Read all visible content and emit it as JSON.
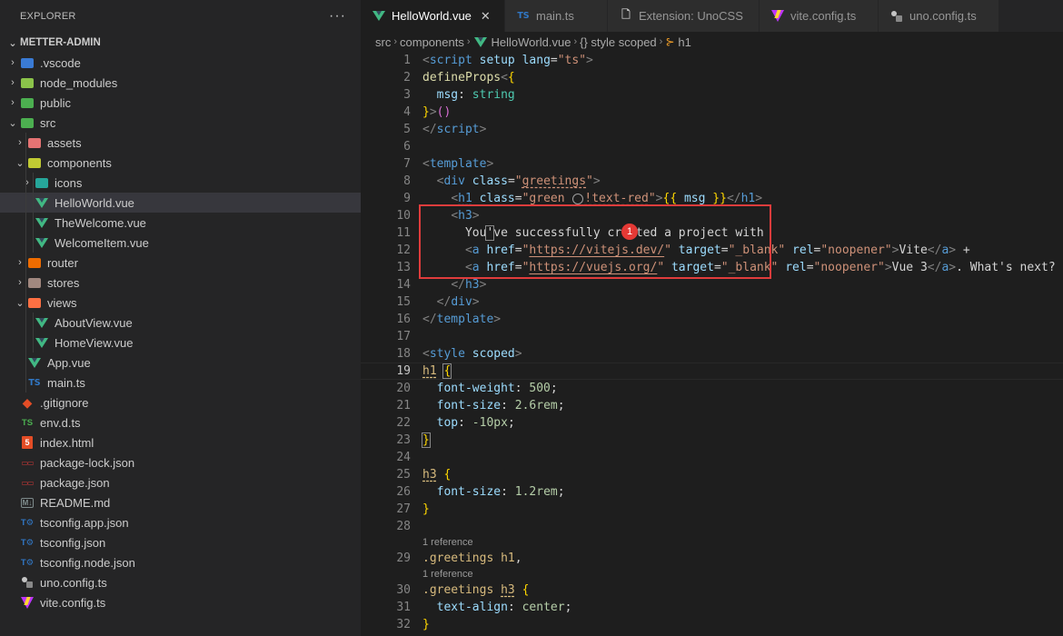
{
  "explorer": {
    "title": "EXPLORER",
    "more": "···",
    "project": "METTER-ADMIN",
    "items": [
      {
        "label": ".vscode",
        "icon": "vscode-folder-icon",
        "kind": "folder-closed",
        "depth": 0
      },
      {
        "label": "node_modules",
        "icon": "node-folder-icon",
        "kind": "folder-closed",
        "depth": 0
      },
      {
        "label": "public",
        "icon": "public-folder-icon",
        "kind": "folder-closed",
        "depth": 0
      },
      {
        "label": "src",
        "icon": "src-folder-icon",
        "kind": "folder-open",
        "depth": 0
      },
      {
        "label": "assets",
        "icon": "assets-folder-icon",
        "kind": "folder-closed",
        "depth": 1
      },
      {
        "label": "components",
        "icon": "components-folder-icon",
        "kind": "folder-open",
        "depth": 1
      },
      {
        "label": "icons",
        "icon": "icons-folder-icon",
        "kind": "folder-closed",
        "depth": 2
      },
      {
        "label": "HelloWorld.vue",
        "icon": "vue-file-icon",
        "kind": "file",
        "depth": 2,
        "selected": true
      },
      {
        "label": "TheWelcome.vue",
        "icon": "vue-file-icon",
        "kind": "file",
        "depth": 2
      },
      {
        "label": "WelcomeItem.vue",
        "icon": "vue-file-icon",
        "kind": "file",
        "depth": 2
      },
      {
        "label": "router",
        "icon": "router-folder-icon",
        "kind": "folder-closed",
        "depth": 1
      },
      {
        "label": "stores",
        "icon": "stores-folder-icon",
        "kind": "folder-closed",
        "depth": 1
      },
      {
        "label": "views",
        "icon": "views-folder-icon",
        "kind": "folder-open",
        "depth": 1
      },
      {
        "label": "AboutView.vue",
        "icon": "vue-file-icon",
        "kind": "file",
        "depth": 2
      },
      {
        "label": "HomeView.vue",
        "icon": "vue-file-icon",
        "kind": "file",
        "depth": 2
      },
      {
        "label": "App.vue",
        "icon": "vue-file-icon",
        "kind": "file",
        "depth": 1
      },
      {
        "label": "main.ts",
        "icon": "ts-file-icon",
        "kind": "file",
        "depth": 1
      },
      {
        "label": ".gitignore",
        "icon": "git-file-icon",
        "kind": "file",
        "depth": 0
      },
      {
        "label": "env.d.ts",
        "icon": "dts-file-icon",
        "kind": "file",
        "depth": 0
      },
      {
        "label": "index.html",
        "icon": "html-file-icon",
        "kind": "file",
        "depth": 0
      },
      {
        "label": "package-lock.json",
        "icon": "npm-file-icon",
        "kind": "file",
        "depth": 0
      },
      {
        "label": "package.json",
        "icon": "npm-file-icon",
        "kind": "file",
        "depth": 0
      },
      {
        "label": "README.md",
        "icon": "markdown-file-icon",
        "kind": "file",
        "depth": 0
      },
      {
        "label": "tsconfig.app.json",
        "icon": "tsconfig-file-icon",
        "kind": "file",
        "depth": 0
      },
      {
        "label": "tsconfig.json",
        "icon": "tsconfig-file-icon",
        "kind": "file",
        "depth": 0
      },
      {
        "label": "tsconfig.node.json",
        "icon": "tsconfig-file-icon",
        "kind": "file",
        "depth": 0
      },
      {
        "label": "uno.config.ts",
        "icon": "unocss-file-icon",
        "kind": "file",
        "depth": 0
      },
      {
        "label": "vite.config.ts",
        "icon": "vite-file-icon",
        "kind": "file",
        "depth": 0
      }
    ]
  },
  "tabs": [
    {
      "label": "HelloWorld.vue",
      "icon": "vue-file-icon",
      "active": true,
      "close": "✕"
    },
    {
      "label": "main.ts",
      "icon": "ts-file-icon",
      "active": false
    },
    {
      "label": "Extension: UnoCSS",
      "icon": "extension-page-icon",
      "active": false
    },
    {
      "label": "vite.config.ts",
      "icon": "vite-file-icon",
      "active": false
    },
    {
      "label": "uno.config.ts",
      "icon": "unocss-file-icon",
      "active": false
    }
  ],
  "breadcrumb": {
    "src": "src",
    "components": "components",
    "file": "HelloWorld.vue",
    "style": "{} style scoped",
    "h1": "h1"
  },
  "badge": "1",
  "code_lens": "1 reference",
  "lines": [
    {
      "n": "1",
      "tokens": [
        [
          "t-punc",
          "<"
        ],
        [
          "t-tag",
          "script"
        ],
        [
          "t-plain",
          " "
        ],
        [
          "t-attr",
          "setup"
        ],
        [
          "t-plain",
          " "
        ],
        [
          "t-attr",
          "lang"
        ],
        [
          "t-plain",
          "="
        ],
        [
          "t-str",
          "\"ts\""
        ],
        [
          "t-punc",
          ">"
        ]
      ]
    },
    {
      "n": "2",
      "tokens": [
        [
          "t-func",
          "defineProps"
        ],
        [
          "t-punc",
          "<"
        ],
        [
          "t-brace",
          "{"
        ]
      ]
    },
    {
      "n": "3",
      "indent": 1,
      "tokens": [
        [
          "t-plain",
          "  "
        ],
        [
          "t-attr",
          "msg"
        ],
        [
          "t-plain",
          ": "
        ],
        [
          "t-type",
          "string"
        ]
      ]
    },
    {
      "n": "4",
      "tokens": [
        [
          "t-brace",
          "}"
        ],
        [
          "t-punc",
          ">"
        ],
        [
          "t-brace2",
          "()"
        ]
      ]
    },
    {
      "n": "5",
      "tokens": [
        [
          "t-punc",
          "</"
        ],
        [
          "t-tag",
          "script"
        ],
        [
          "t-punc",
          ">"
        ]
      ]
    },
    {
      "n": "6",
      "tokens": []
    },
    {
      "n": "7",
      "tokens": [
        [
          "t-punc",
          "<"
        ],
        [
          "t-tag",
          "template"
        ],
        [
          "t-punc",
          ">"
        ]
      ]
    },
    {
      "n": "8",
      "tokens": [
        [
          "t-plain",
          "  "
        ],
        [
          "t-punc",
          "<"
        ],
        [
          "t-tag",
          "div"
        ],
        [
          "t-plain",
          " "
        ],
        [
          "t-attr",
          "class"
        ],
        [
          "t-plain",
          "="
        ],
        [
          "t-str",
          "\""
        ],
        [
          "t-str ul",
          "greetings"
        ],
        [
          "t-str",
          "\""
        ],
        [
          "t-punc",
          ">"
        ]
      ]
    },
    {
      "n": "9",
      "tokens": [
        [
          "t-plain",
          "    "
        ],
        [
          "t-punc",
          "<"
        ],
        [
          "t-tag ul",
          "h1"
        ],
        [
          "t-plain",
          " "
        ],
        [
          "t-attr",
          "class"
        ],
        [
          "t-plain",
          "="
        ],
        [
          "t-str",
          "\"green "
        ],
        [
          "circle",
          ""
        ],
        [
          "t-str ul",
          "!text-red"
        ],
        [
          "t-str",
          "\""
        ],
        [
          "t-punc",
          ">"
        ],
        [
          "t-brace",
          "{{"
        ],
        [
          "t-plain",
          " "
        ],
        [
          "t-attr",
          "msg"
        ],
        [
          "t-plain",
          " "
        ],
        [
          "t-brace",
          "}}"
        ],
        [
          "t-punc",
          "</"
        ],
        [
          "t-tag",
          "h1"
        ],
        [
          "t-punc",
          ">"
        ]
      ]
    },
    {
      "n": "10",
      "tokens": [
        [
          "t-plain",
          "    "
        ],
        [
          "t-punc",
          "<"
        ],
        [
          "t-tag",
          "h3"
        ],
        [
          "t-punc",
          ">"
        ]
      ]
    },
    {
      "n": "11",
      "tokens": [
        [
          "t-plain",
          "      You"
        ],
        [
          "t-plain cursor-box",
          "'"
        ],
        [
          "t-plain",
          "ve successfully created a project with"
        ]
      ]
    },
    {
      "n": "12",
      "tokens": [
        [
          "t-plain",
          "      "
        ],
        [
          "t-punc",
          "<"
        ],
        [
          "t-tag",
          "a"
        ],
        [
          "t-plain",
          " "
        ],
        [
          "t-attr",
          "href"
        ],
        [
          "t-plain",
          "="
        ],
        [
          "t-str",
          "\""
        ],
        [
          "t-str uls",
          "https://vitejs.dev/"
        ],
        [
          "t-str",
          "\""
        ],
        [
          "t-plain",
          " "
        ],
        [
          "t-attr",
          "target"
        ],
        [
          "t-plain",
          "="
        ],
        [
          "t-str",
          "\"_blank\""
        ],
        [
          "t-plain",
          " "
        ],
        [
          "t-attr",
          "rel"
        ],
        [
          "t-plain",
          "="
        ],
        [
          "t-str",
          "\"noopener\""
        ],
        [
          "t-punc",
          ">"
        ],
        [
          "t-plain",
          "Vite"
        ],
        [
          "t-punc",
          "</"
        ],
        [
          "t-tag",
          "a"
        ],
        [
          "t-punc",
          ">"
        ],
        [
          "t-plain",
          " +"
        ]
      ]
    },
    {
      "n": "13",
      "tokens": [
        [
          "t-plain",
          "      "
        ],
        [
          "t-punc",
          "<"
        ],
        [
          "t-tag",
          "a"
        ],
        [
          "t-plain",
          " "
        ],
        [
          "t-attr",
          "href"
        ],
        [
          "t-plain",
          "="
        ],
        [
          "t-str",
          "\""
        ],
        [
          "t-str uls",
          "https://vuejs.org/"
        ],
        [
          "t-str",
          "\""
        ],
        [
          "t-plain",
          " "
        ],
        [
          "t-attr",
          "target"
        ],
        [
          "t-plain",
          "="
        ],
        [
          "t-str",
          "\"_blank\""
        ],
        [
          "t-plain",
          " "
        ],
        [
          "t-attr",
          "rel"
        ],
        [
          "t-plain",
          "="
        ],
        [
          "t-str",
          "\"noopener\""
        ],
        [
          "t-punc",
          ">"
        ],
        [
          "t-plain",
          "Vue 3"
        ],
        [
          "t-punc",
          "</"
        ],
        [
          "t-tag",
          "a"
        ],
        [
          "t-punc",
          ">"
        ],
        [
          "t-plain",
          ". What's next?"
        ]
      ]
    },
    {
      "n": "14",
      "tokens": [
        [
          "t-plain",
          "    "
        ],
        [
          "t-punc",
          "</"
        ],
        [
          "t-tag",
          "h3"
        ],
        [
          "t-punc",
          ">"
        ]
      ]
    },
    {
      "n": "15",
      "tokens": [
        [
          "t-plain",
          "  "
        ],
        [
          "t-punc",
          "</"
        ],
        [
          "t-tag",
          "div"
        ],
        [
          "t-punc",
          ">"
        ]
      ]
    },
    {
      "n": "16",
      "tokens": [
        [
          "t-punc",
          "</"
        ],
        [
          "t-tag",
          "template"
        ],
        [
          "t-punc",
          ">"
        ]
      ]
    },
    {
      "n": "17",
      "tokens": []
    },
    {
      "n": "18",
      "tokens": [
        [
          "t-punc",
          "<"
        ],
        [
          "t-tag",
          "style"
        ],
        [
          "t-plain",
          " "
        ],
        [
          "t-attr",
          "scoped"
        ],
        [
          "t-punc",
          ">"
        ]
      ]
    },
    {
      "n": "19",
      "current": true,
      "tokens": [
        [
          "t-sel ul",
          "h1"
        ],
        [
          "t-plain",
          " "
        ],
        [
          "t-brace cursor-box",
          "{"
        ]
      ]
    },
    {
      "n": "20",
      "tokens": [
        [
          "t-plain",
          "  "
        ],
        [
          "t-prop",
          "font-weight"
        ],
        [
          "t-plain",
          ": "
        ],
        [
          "t-num",
          "500"
        ],
        [
          "t-plain",
          ";"
        ]
      ]
    },
    {
      "n": "21",
      "tokens": [
        [
          "t-plain",
          "  "
        ],
        [
          "t-prop",
          "font-size"
        ],
        [
          "t-plain",
          ": "
        ],
        [
          "t-num",
          "2.6rem"
        ],
        [
          "t-plain",
          ";"
        ]
      ]
    },
    {
      "n": "22",
      "tokens": [
        [
          "t-plain",
          "  "
        ],
        [
          "t-prop",
          "top"
        ],
        [
          "t-plain",
          ": "
        ],
        [
          "t-num",
          "-10px"
        ],
        [
          "t-plain",
          ";"
        ]
      ]
    },
    {
      "n": "23",
      "tokens": [
        [
          "t-brace cursor-box",
          "}"
        ]
      ]
    },
    {
      "n": "24",
      "tokens": []
    },
    {
      "n": "25",
      "tokens": [
        [
          "t-sel ul",
          "h3"
        ],
        [
          "t-plain",
          " "
        ],
        [
          "t-brace",
          "{"
        ]
      ]
    },
    {
      "n": "26",
      "tokens": [
        [
          "t-plain",
          "  "
        ],
        [
          "t-prop",
          "font-size"
        ],
        [
          "t-plain",
          ": "
        ],
        [
          "t-num",
          "1.2rem"
        ],
        [
          "t-plain",
          ";"
        ]
      ]
    },
    {
      "n": "27",
      "tokens": [
        [
          "t-brace",
          "}"
        ]
      ]
    },
    {
      "n": "28",
      "tokens": []
    },
    {
      "n": "29",
      "lens": true,
      "tokens": [
        [
          "t-sel",
          ".greetings"
        ],
        [
          "t-plain",
          " "
        ],
        [
          "t-sel",
          "h1"
        ],
        [
          "t-plain",
          ","
        ]
      ]
    },
    {
      "n": "30",
      "lens": true,
      "tokens": [
        [
          "t-sel",
          ".greetings"
        ],
        [
          "t-plain",
          " "
        ],
        [
          "t-sel ul",
          "h3"
        ],
        [
          "t-plain",
          " "
        ],
        [
          "t-brace",
          "{"
        ]
      ]
    },
    {
      "n": "31",
      "tokens": [
        [
          "t-plain",
          "  "
        ],
        [
          "t-prop",
          "text-align"
        ],
        [
          "t-plain",
          ": "
        ],
        [
          "t-num",
          "center"
        ],
        [
          "t-plain",
          ";"
        ]
      ]
    },
    {
      "n": "32",
      "tokens": [
        [
          "t-brace",
          "}"
        ]
      ]
    }
  ],
  "colors": {
    "accent_red": "#e03c3c",
    "vue_green": "#41b883",
    "ts_blue": "#3178c6"
  }
}
